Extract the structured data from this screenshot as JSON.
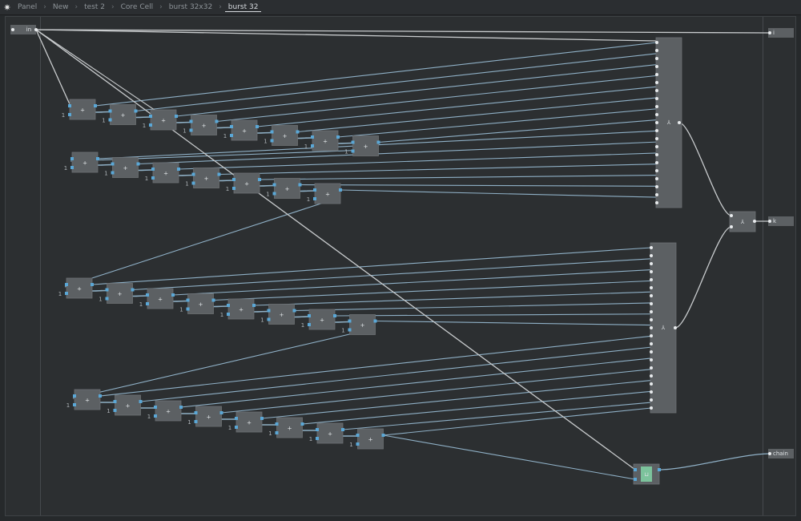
{
  "breadcrumb": {
    "items": [
      "Panel",
      "New",
      "test 2",
      "Core Cell",
      "burst 32x32",
      "burst 32"
    ],
    "active_index": 5
  },
  "io": {
    "input_label": "in",
    "outputs": [
      "i",
      "k",
      "chain"
    ]
  },
  "graph": {
    "add_symbol": "+",
    "constant_label": "1",
    "node_count_per_row": [
      8,
      7,
      8,
      8
    ],
    "merge_symbol": "⅄",
    "loop_symbol": "⊔"
  },
  "colors": {
    "wire_white": "#c9ccce",
    "wire_blue": "#8fb0c6",
    "port_blue": "#5aa7d6",
    "node_fill": "#5c6063",
    "loop_fill": "#7cc39c",
    "background": "#2c2f31"
  }
}
